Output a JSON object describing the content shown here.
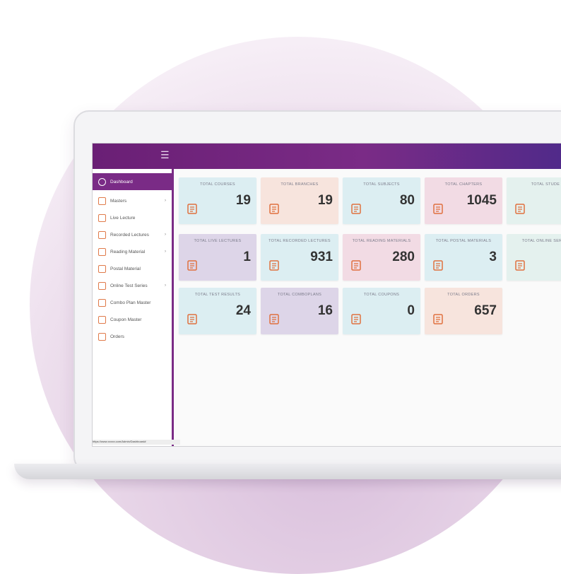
{
  "topbar": {
    "menu_icon": "☰"
  },
  "sidebar": {
    "items": [
      {
        "label": "Dashboard",
        "icon": "dashboard-icon",
        "arrow": ""
      },
      {
        "label": "Masters",
        "icon": "masters-icon",
        "arrow": "›"
      },
      {
        "label": "Live Lecture",
        "icon": "live-lecture-icon",
        "arrow": ""
      },
      {
        "label": "Recorded Lectures",
        "icon": "recorded-lecture-icon",
        "arrow": "›"
      },
      {
        "label": "Reading Material",
        "icon": "reading-material-icon",
        "arrow": "›"
      },
      {
        "label": "Postal Material",
        "icon": "postal-material-icon",
        "arrow": ""
      },
      {
        "label": "Online Test Series",
        "icon": "test-series-icon",
        "arrow": "›"
      },
      {
        "label": "Combo Plan Master",
        "icon": "combo-plan-icon",
        "arrow": ""
      },
      {
        "label": "Coupon Master",
        "icon": "coupon-icon",
        "arrow": ""
      },
      {
        "label": "Orders",
        "icon": "orders-icon",
        "arrow": ""
      }
    ],
    "status_bar": "https://www.xxxxx.com/Admin/Dashboard#"
  },
  "cards": [
    {
      "label": "TOTAL COURSES",
      "value": "19",
      "icon": "courses-icon",
      "color": "blue"
    },
    {
      "label": "TOTAL BRANCHES",
      "value": "19",
      "icon": "branches-icon",
      "color": "peach"
    },
    {
      "label": "TOTAL SUBJECTS",
      "value": "80",
      "icon": "subjects-icon",
      "color": "blue"
    },
    {
      "label": "TOTAL CHAPTERS",
      "value": "1045",
      "icon": "chapters-icon",
      "color": "pink"
    },
    {
      "label": "TOTAL STUDE",
      "value": "",
      "icon": "students-icon",
      "color": "mint"
    },
    {
      "label": "TOTAL LIVE LECTURES",
      "value": "1",
      "icon": "live-lectures-icon",
      "color": "lav"
    },
    {
      "label": "TOTAL RECORDED LECTURES",
      "value": "931",
      "icon": "recorded-lectures-icon",
      "color": "blue"
    },
    {
      "label": "TOTAL READING MATERIALS",
      "value": "280",
      "icon": "reading-materials-icon",
      "color": "pink"
    },
    {
      "label": "TOTAL POSTAL MATERIALS",
      "value": "3",
      "icon": "postal-materials-icon",
      "color": "blue"
    },
    {
      "label": "TOTAL ONLINE SERIES",
      "value": "",
      "icon": "online-series-icon",
      "color": "mint"
    },
    {
      "label": "TOTAL TEST RESULTS",
      "value": "24",
      "icon": "test-results-icon",
      "color": "blue"
    },
    {
      "label": "TOTAL COMBOPLANS",
      "value": "16",
      "icon": "comboplans-icon",
      "color": "lav"
    },
    {
      "label": "TOTAL COUPONS",
      "value": "0",
      "icon": "coupons-icon",
      "color": "blue"
    },
    {
      "label": "TOTAL ORDERS",
      "value": "657",
      "icon": "orders-icon",
      "color": "peach"
    }
  ]
}
